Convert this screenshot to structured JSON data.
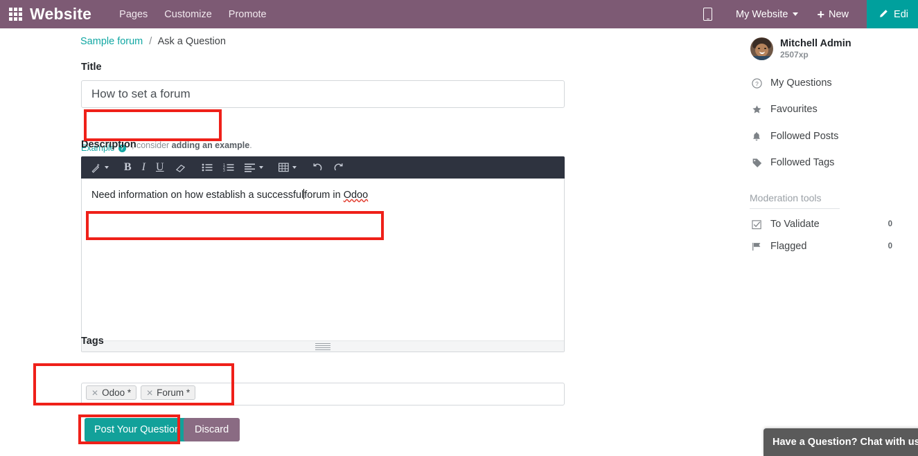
{
  "navbar": {
    "apps_icon": "apps-grid-icon",
    "brand": "Website",
    "links": [
      "Pages",
      "Customize",
      "Promote"
    ],
    "mobile_preview_icon": "mobile-phone-icon",
    "website_selector": "My Website",
    "new_label": "New",
    "new_icon": "plus-icon",
    "edit_label": "Edi",
    "edit_icon": "pencil-icon",
    "brand_color": "#7d5a74",
    "edit_color": "#00a09d"
  },
  "breadcrumb": {
    "root": "Sample forum",
    "separator": "/",
    "current": "Ask a Question"
  },
  "form": {
    "title_label": "Title",
    "title_value": "How to set a forum",
    "title_placeholder": "",
    "example_link": "Example",
    "example_icon": "question-circle-icon",
    "description_label": "Description",
    "description_hint_pre": ", consider ",
    "description_hint_link": "adding an example",
    "description_hint_post": ".",
    "description_text_before_caret": "Need information on how establish a successful",
    "description_text_after_caret": "forum in ",
    "description_misspelled_word": "Odoo",
    "tags_label": "Tags",
    "tags": [
      "Odoo *",
      "Forum *"
    ],
    "tag_remove_icon": "close-icon",
    "post_button": "Post Your Question",
    "discard_button": "Discard",
    "post_color": "#12a19a",
    "discard_color": "#8a6b83"
  },
  "editor_toolbar": {
    "buttons": [
      {
        "name": "style-magic-wand",
        "glyph": "✎",
        "caret": true
      },
      {
        "name": "bold",
        "glyph": "B",
        "caret": false
      },
      {
        "name": "italic",
        "glyph": "I",
        "caret": false
      },
      {
        "name": "underline",
        "glyph": "U",
        "caret": false
      },
      {
        "name": "clear-format-eraser",
        "glyph": "▱",
        "caret": false
      },
      {
        "name": "unordered-list",
        "glyph": "☰",
        "caret": false
      },
      {
        "name": "ordered-list",
        "glyph": "☰",
        "caret": false
      },
      {
        "name": "align",
        "glyph": "≡",
        "caret": true
      },
      {
        "name": "table",
        "glyph": "⊞",
        "caret": true
      },
      {
        "name": "undo",
        "glyph": "↺",
        "caret": false
      },
      {
        "name": "redo",
        "glyph": "↻",
        "caret": false
      }
    ],
    "background": "#2e333f"
  },
  "sidebar": {
    "user": {
      "name": "Mitchell Admin",
      "xp": "2507xp",
      "avatar": "user-avatar"
    },
    "items": [
      {
        "label": "My Questions",
        "icon": "question-circle-icon"
      },
      {
        "label": "Favourites",
        "icon": "star-icon"
      },
      {
        "label": "Followed Posts",
        "icon": "bell-icon"
      },
      {
        "label": "Followed Tags",
        "icon": "tag-icon"
      }
    ],
    "moderation_title": "Moderation tools",
    "moderation_items": [
      {
        "label": "To Validate",
        "icon": "check-square-icon",
        "count": "0"
      },
      {
        "label": "Flagged",
        "icon": "flag-icon",
        "count": "0"
      }
    ]
  },
  "chat": {
    "label": "Have a Question? Chat with us"
  },
  "annotations": {
    "color": "#ef2019"
  }
}
